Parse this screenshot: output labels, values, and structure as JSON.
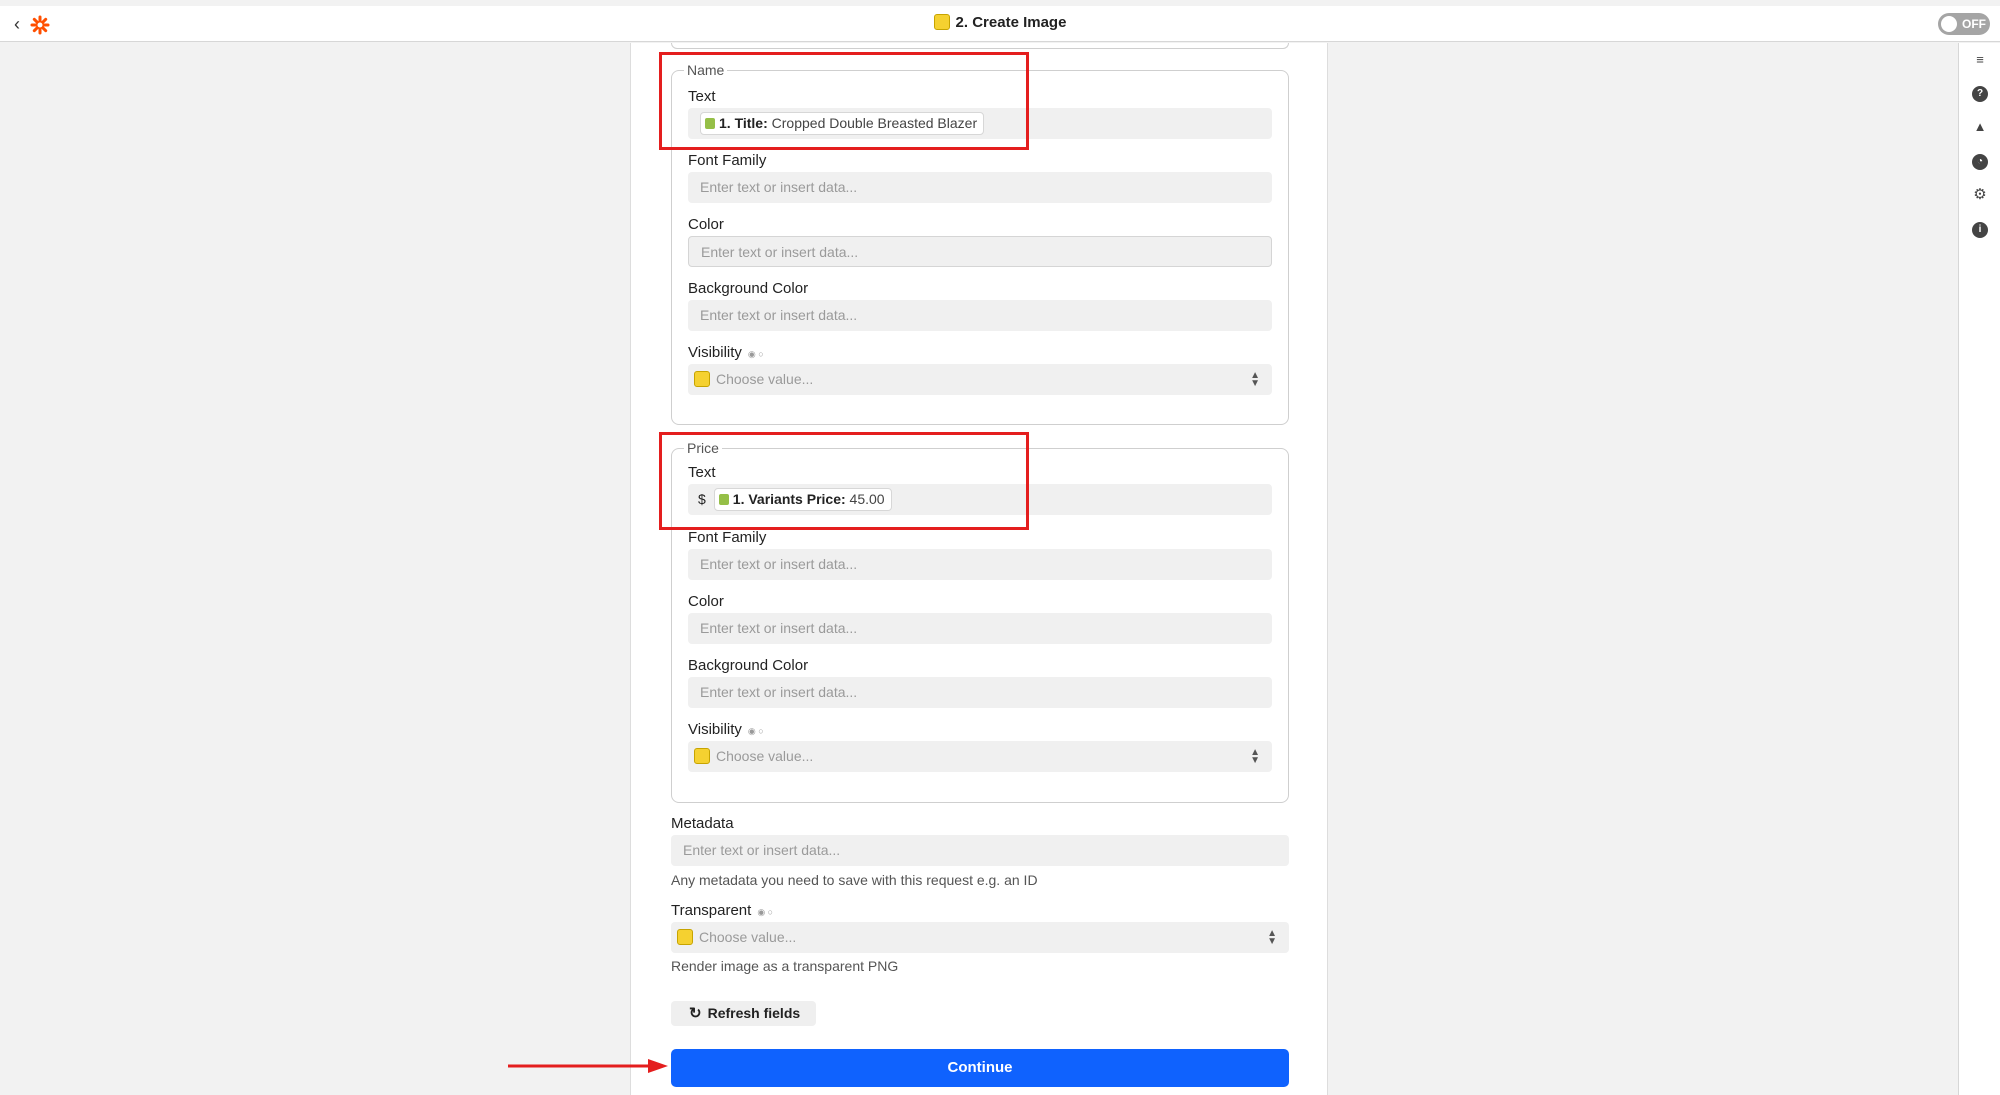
{
  "header": {
    "step_title": "2. Create Image",
    "toggle_label": "OFF"
  },
  "name_group": {
    "legend": "Name",
    "text_label": "Text",
    "text_pill_key": "1. Title:",
    "text_pill_value": "Cropped Double Breasted Blazer",
    "font_family_label": "Font Family",
    "font_family_placeholder": "Enter text or insert data...",
    "color_label": "Color",
    "color_placeholder": "Enter text or insert data...",
    "background_color_label": "Background Color",
    "background_color_placeholder": "Enter text or insert data...",
    "visibility_label": "Visibility",
    "visibility_placeholder": "Choose value..."
  },
  "price_group": {
    "legend": "Price",
    "text_label": "Text",
    "text_prefix": "$",
    "text_pill_key": "1. Variants Price:",
    "text_pill_value": "45.00",
    "font_family_label": "Font Family",
    "font_family_placeholder": "Enter text or insert data...",
    "color_label": "Color",
    "color_placeholder": "Enter text or insert data...",
    "background_color_label": "Background Color",
    "background_color_placeholder": "Enter text or insert data...",
    "visibility_label": "Visibility",
    "visibility_placeholder": "Choose value..."
  },
  "metadata": {
    "label": "Metadata",
    "placeholder": "Enter text or insert data...",
    "help": "Any metadata you need to save with this request e.g. an ID"
  },
  "transparent": {
    "label": "Transparent",
    "placeholder": "Choose value...",
    "help": "Render image as a transparent PNG"
  },
  "buttons": {
    "refresh": "Refresh fields",
    "continue": "Continue"
  },
  "icons": [
    "back-icon",
    "zapier-logo-icon",
    "app-icon",
    "outline-icon",
    "help-icon",
    "alert-icon",
    "history-icon",
    "settings-icon",
    "info-icon",
    "shopify-icon",
    "refresh-icon",
    "select-arrows-icon"
  ],
  "colors": {
    "primary": "#0f62fe",
    "annotation_red": "#e41e1e",
    "app_yellow": "#f5d130"
  }
}
